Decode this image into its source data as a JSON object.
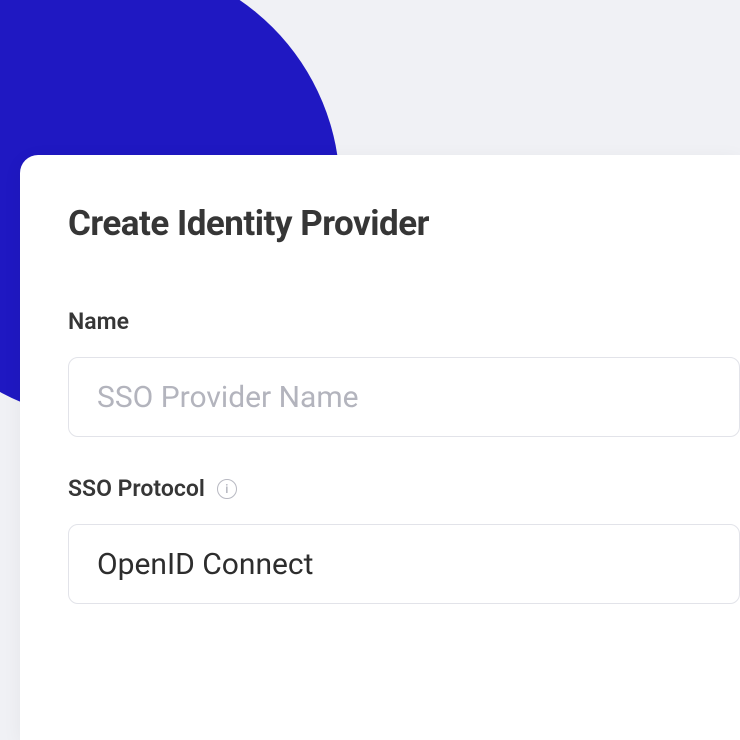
{
  "page": {
    "title": "Create Identity Provider"
  },
  "form": {
    "name": {
      "label": "Name",
      "placeholder": "SSO Provider Name",
      "value": ""
    },
    "protocol": {
      "label": "SSO Protocol",
      "selected": "OpenID Connect"
    }
  }
}
